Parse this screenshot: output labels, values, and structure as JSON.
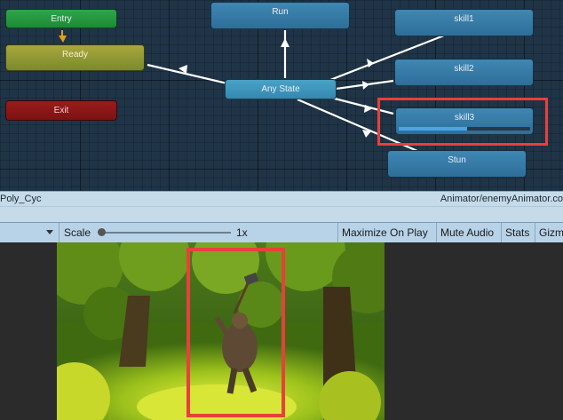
{
  "animator": {
    "states": {
      "entry": "Entry",
      "ready": "Ready",
      "exit": "Exit",
      "run": "Run",
      "any_state": "Any State",
      "skill1": "skill1",
      "skill2": "skill2",
      "skill3": "skill3",
      "stun": "Stun"
    },
    "skill3_progress": 0.52,
    "highlight_color": "#e8403c"
  },
  "status_bar": {
    "left_text": "Poly_Cyc",
    "right_text": "Animator/enemyAnimator.co"
  },
  "game_toolbar": {
    "scale_label": "Scale",
    "scale_value": "1x",
    "maximize_on_play": "Maximize On Play",
    "mute_audio": "Mute Audio",
    "stats": "Stats",
    "gizmos": "Gizm"
  }
}
